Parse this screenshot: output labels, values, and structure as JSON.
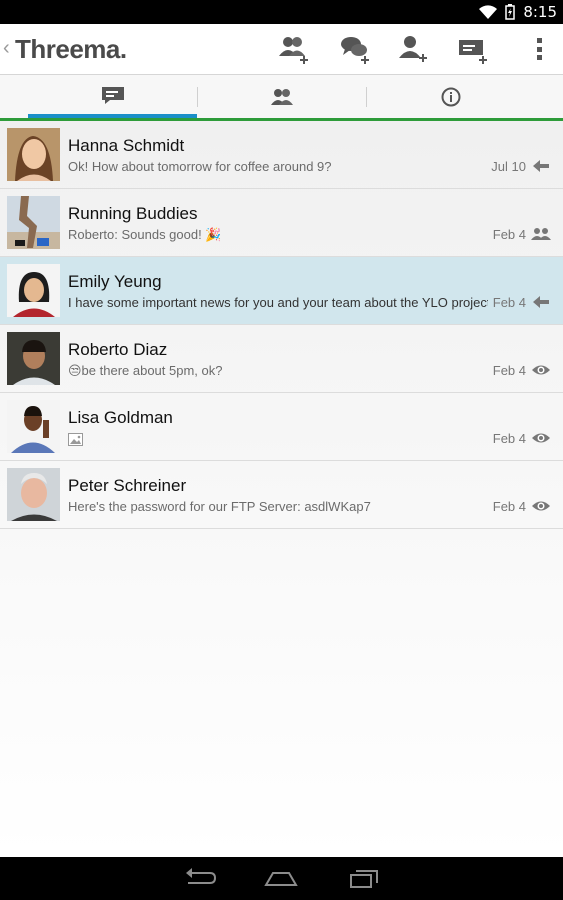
{
  "status_bar": {
    "time": "8:15"
  },
  "action_bar": {
    "app_title": "Threema.",
    "actions": [
      "new-group-icon",
      "new-chat-icon",
      "add-contact-icon",
      "new-distribution-list-icon",
      "overflow-menu-icon"
    ]
  },
  "tabs": [
    {
      "icon": "chats-icon",
      "selected": true
    },
    {
      "icon": "contacts-icon",
      "selected": false
    },
    {
      "icon": "info-icon",
      "selected": false
    }
  ],
  "conversations": [
    {
      "name": "Hanna Schmidt",
      "preview": "Ok! How about tomorrow for coffee around 9?",
      "date": "Jul 10",
      "status_icon": "reply-arrow-icon",
      "selected": false
    },
    {
      "name": "Running Buddies",
      "preview": "Roberto:  Sounds good! 🎉",
      "date": "Feb 4",
      "status_icon": "group-icon",
      "selected": false
    },
    {
      "name": "Emily Yeung",
      "preview": "I have some important news for you and your team about the YLO project",
      "date": "Feb 4",
      "status_icon": "reply-arrow-icon",
      "selected": true
    },
    {
      "name": "Roberto Diaz",
      "preview": "😒be there about 5pm, ok?",
      "date": "Feb 4",
      "status_icon": "read-eye-icon",
      "selected": false
    },
    {
      "name": "Lisa Goldman",
      "preview": "",
      "preview_icon": "image-icon",
      "date": "Feb 4",
      "status_icon": "read-eye-icon",
      "selected": false
    },
    {
      "name": "Peter Schreiner",
      "preview": "Here's the password for our FTP Server: asdlWKap7",
      "date": "Feb 4",
      "status_icon": "read-eye-icon",
      "selected": false
    }
  ],
  "colors": {
    "accent_green": "#2e9c3a",
    "tab_indicator_blue": "#1a8fc8",
    "selected_row": "#d1e6ed"
  }
}
